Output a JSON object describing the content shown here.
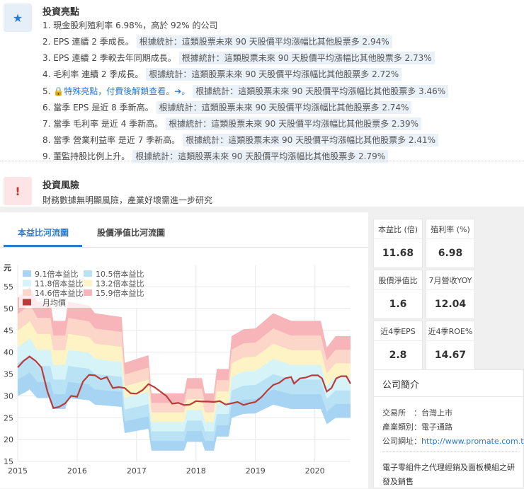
{
  "highlights": {
    "title": "投資亮點",
    "icon": "star-icon",
    "items": [
      {
        "n": "1.",
        "text": "現金股利殖利率 6.98%，高於 92% 的公司",
        "stat": ""
      },
      {
        "n": "2.",
        "text": "EPS 連續 2 季成長。",
        "stat": "根據統計：這類股票未來 90 天股價平均漲幅比其他股票多 2.94%"
      },
      {
        "n": "3.",
        "text": "EPS 連續 2 季較去年同期成長。",
        "stat": "根據統計：這類股票未來 90 天股價平均漲幅比其他股票多 2.73%"
      },
      {
        "n": "4.",
        "text": "毛利率 連續 2 季成長。",
        "stat": "根據統計：這類股票未來 90 天股價平均漲幅比其他股票多 2.72%"
      },
      {
        "n": "5.",
        "text": "特殊亮點，付費後解鎖查看。➔。",
        "stat": "根據統計：這類股票未來 90 天股價平均漲幅比其他股票多 3.46%",
        "locked": true
      },
      {
        "n": "6.",
        "text": "當季 EPS 是近 8 季新高。",
        "stat": "根據統計：這類股票未來 90 天股價平均漲幅比其他股票多 2.74%"
      },
      {
        "n": "7.",
        "text": "當季 毛利率 是近 4 季新高。",
        "stat": "根據統計：這類股票未來 90 天股價平均漲幅比其他股票多 2.39%"
      },
      {
        "n": "8.",
        "text": "當季 營業利益率 是近 7 季新高。",
        "stat": "根據統計：這類股票未來 90 天股價平均漲幅比其他股票多 2.41%"
      },
      {
        "n": "9.",
        "text": "董監持股比例上升。",
        "stat": "根據統計：這類股票未來 90 天股價平均漲幅比其他股票多 2.79%"
      }
    ]
  },
  "risk": {
    "title": "投資風險",
    "text": "財務數據無明顯風險，產業好壞需進一步研究",
    "icon": "exclamation-icon"
  },
  "tabs": [
    {
      "label": "本益比河流圖",
      "active": true
    },
    {
      "label": "股價淨值比河流圖",
      "active": false
    }
  ],
  "metrics": [
    {
      "label": "本益比 (倍)",
      "value": "11.68"
    },
    {
      "label": "殖利率 (%)",
      "value": "6.98"
    },
    {
      "label": "股價淨值比",
      "value": "1.6"
    },
    {
      "label": "7月營收YOY",
      "value": "12.04"
    },
    {
      "label": "近4季EPS",
      "value": "2.8"
    },
    {
      "label": "近4季ROE%",
      "value": "14.67"
    }
  ],
  "company": {
    "title": "公司簡介",
    "exchange_label": "交易所　：",
    "exchange": "台灣上市",
    "industry_label": "產業類別：",
    "industry": "電子通路",
    "website_label": "公司網址：",
    "website": "http://www.promate.com.tw",
    "description": "電子零組件之代理經銷及面板模組之研發及銷售"
  },
  "colors": {
    "accent": "#2a7ad2",
    "price": "#b83c3c",
    "bands": [
      "#a6d4f2",
      "#b9e3f5",
      "#d6f4f8",
      "#fdf3c4",
      "#fcd6c8",
      "#f7b5b9"
    ]
  },
  "chart_data": {
    "type": "area",
    "yunit": "元",
    "ylim": [
      15,
      55
    ],
    "yticks": [
      15,
      20,
      25,
      30,
      35,
      40,
      45,
      50,
      55
    ],
    "xlim": [
      2015,
      2020.6
    ],
    "xticks": [
      "2015",
      "2016",
      "2017",
      "2018",
      "2019",
      "2020"
    ],
    "legend": [
      {
        "name": "9.1倍本益比"
      },
      {
        "name": "10.5倍本益比"
      },
      {
        "name": "11.8倍本益比"
      },
      {
        "name": "13.2倍本益比"
      },
      {
        "name": "14.6倍本益比"
      },
      {
        "name": "15.9倍本益比"
      },
      {
        "name": "月均價"
      }
    ],
    "band_base": {
      "x": [
        2015,
        2015.15,
        2015.2,
        2015.33,
        2015.55,
        2015.6,
        2015.8,
        2015.85,
        2016.2,
        2016.3,
        2016.75,
        2016.8,
        2017.2,
        2017.25,
        2017.8,
        2017.85,
        2018.1,
        2018.15,
        2018.3,
        2018.35,
        2018.55,
        2018.6,
        2018.8,
        2019.0,
        2019.3,
        2019.6,
        2020.1,
        2020.2,
        2020.35,
        2020.6
      ],
      "values": [
        30,
        31,
        31.5,
        29.5,
        29.5,
        27,
        27,
        29.5,
        29,
        28,
        27.5,
        21.5,
        22.5,
        17.5,
        17.5,
        19.5,
        19.5,
        17.5,
        17.5,
        20.7,
        20.7,
        25,
        25.9,
        26,
        28,
        27,
        27,
        23.5,
        25,
        25
      ]
    },
    "top_ratio": 1.747,
    "price": {
      "name": "月均價",
      "x": [
        2015,
        2015.1,
        2015.2,
        2015.3,
        2015.4,
        2015.5,
        2015.6,
        2015.7,
        2015.8,
        2015.9,
        2016,
        2016.1,
        2016.2,
        2016.3,
        2016.4,
        2016.5,
        2016.6,
        2016.7,
        2016.8,
        2016.9,
        2017,
        2017.1,
        2017.2,
        2017.3,
        2017.4,
        2017.5,
        2017.6,
        2017.7,
        2017.8,
        2017.9,
        2018,
        2018.1,
        2018.2,
        2018.3,
        2018.4,
        2018.5,
        2018.6,
        2018.7,
        2018.8,
        2018.9,
        2019,
        2019.1,
        2019.2,
        2019.3,
        2019.4,
        2019.5,
        2019.6,
        2019.65,
        2019.75,
        2019.85,
        2019.95,
        2020.05,
        2020.12,
        2020.2,
        2020.28,
        2020.36,
        2020.44,
        2020.53,
        2020.6
      ],
      "values": [
        36.5,
        38,
        39,
        38,
        36.5,
        31,
        27.2,
        27.5,
        28.3,
        30,
        29.8,
        33.3,
        34.8,
        34.7,
        33.8,
        34.3,
        31.8,
        32,
        31.8,
        30.6,
        30.5,
        31.3,
        32.7,
        32,
        31,
        30,
        28.2,
        28.4,
        27.9,
        28,
        28.8,
        28.7,
        28.7,
        28.6,
        28.8,
        28,
        28.3,
        28.6,
        27.9,
        28.3,
        28.6,
        29.7,
        31.2,
        32.5,
        33,
        34,
        34.3,
        32.8,
        34,
        34.2,
        34.7,
        34.7,
        34,
        31,
        31.8,
        34,
        34.5,
        34.5,
        32.8
      ]
    }
  }
}
